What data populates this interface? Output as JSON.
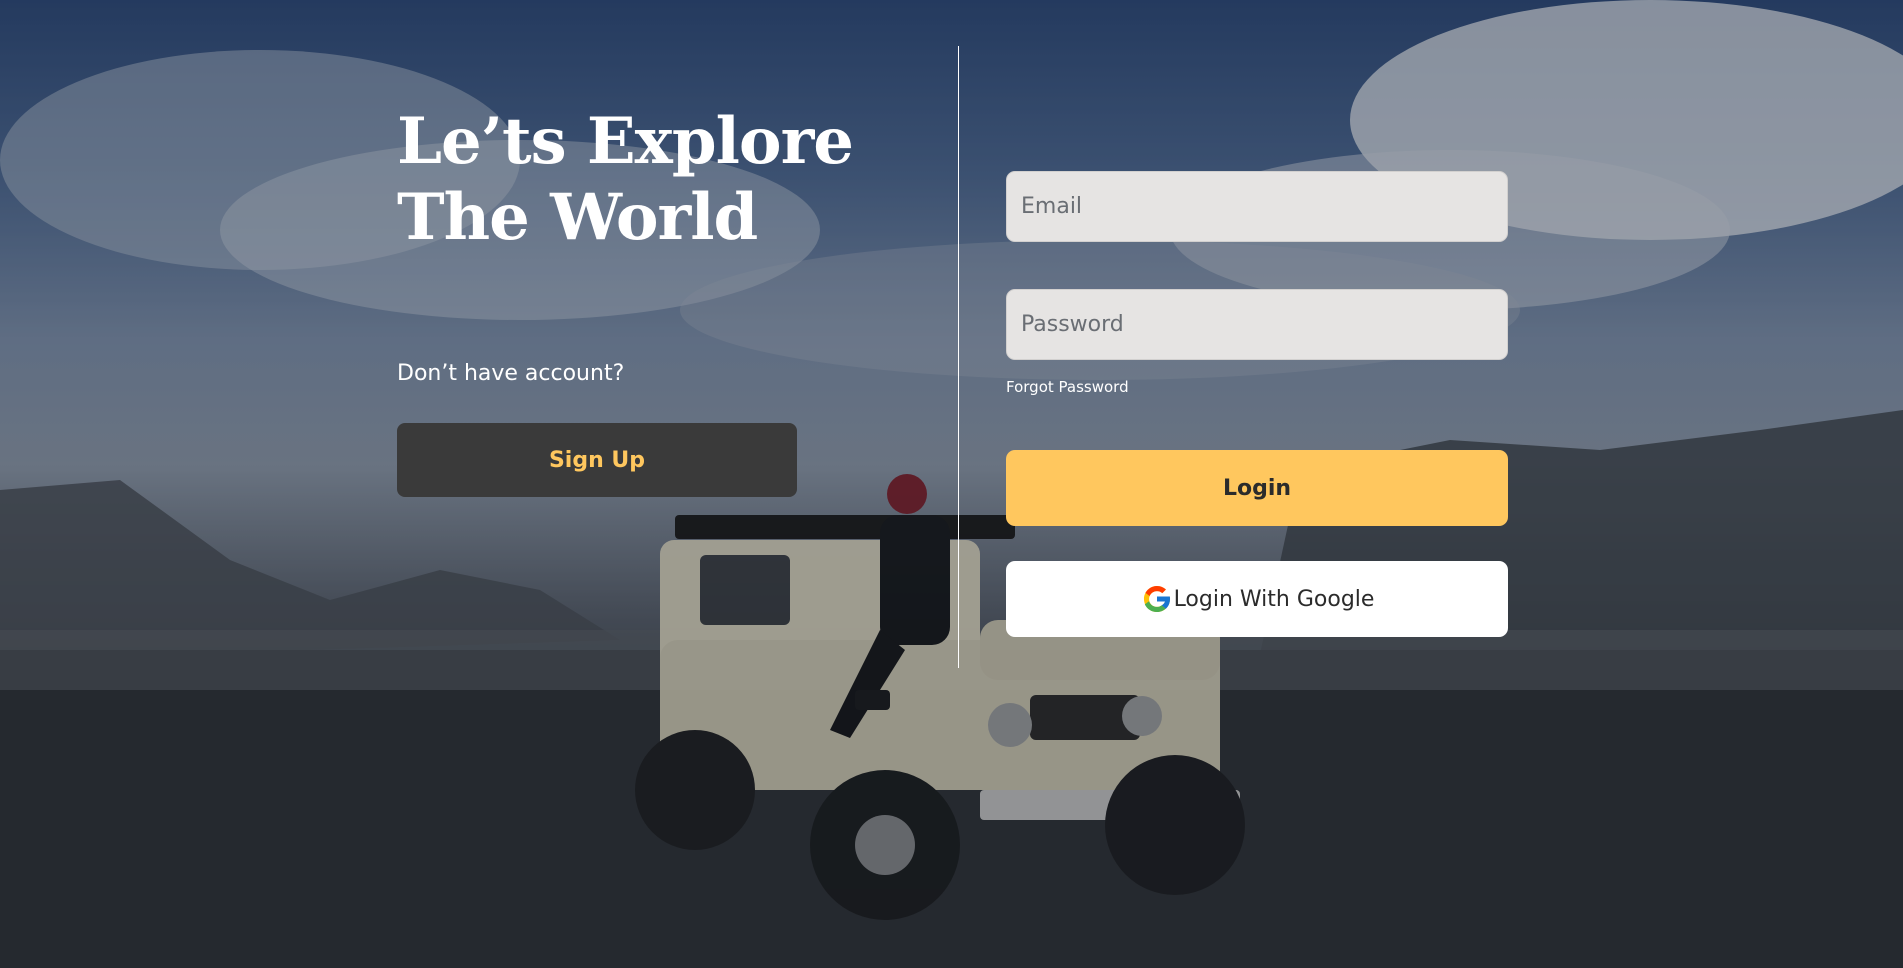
{
  "hero": {
    "title_line1": "Le’ts Explore",
    "title_line2": "The World"
  },
  "signup": {
    "prompt": "Don’t have account?",
    "button_label": "Sign Up"
  },
  "login_form": {
    "email_placeholder": "Email",
    "email_value": "",
    "password_placeholder": "Password",
    "password_value": "",
    "forgot_password_label": "Forgot Password",
    "login_button_label": "Login",
    "google_button_label": "Login With Google",
    "google_icon": "google-g-icon"
  },
  "colors": {
    "accent_yellow": "#ffc75e",
    "dark_button": "#3a3a3a",
    "input_background": "#e6e4e3",
    "text_white": "#ffffff"
  },
  "background": {
    "type": "photo",
    "subject": "background-photo"
  }
}
